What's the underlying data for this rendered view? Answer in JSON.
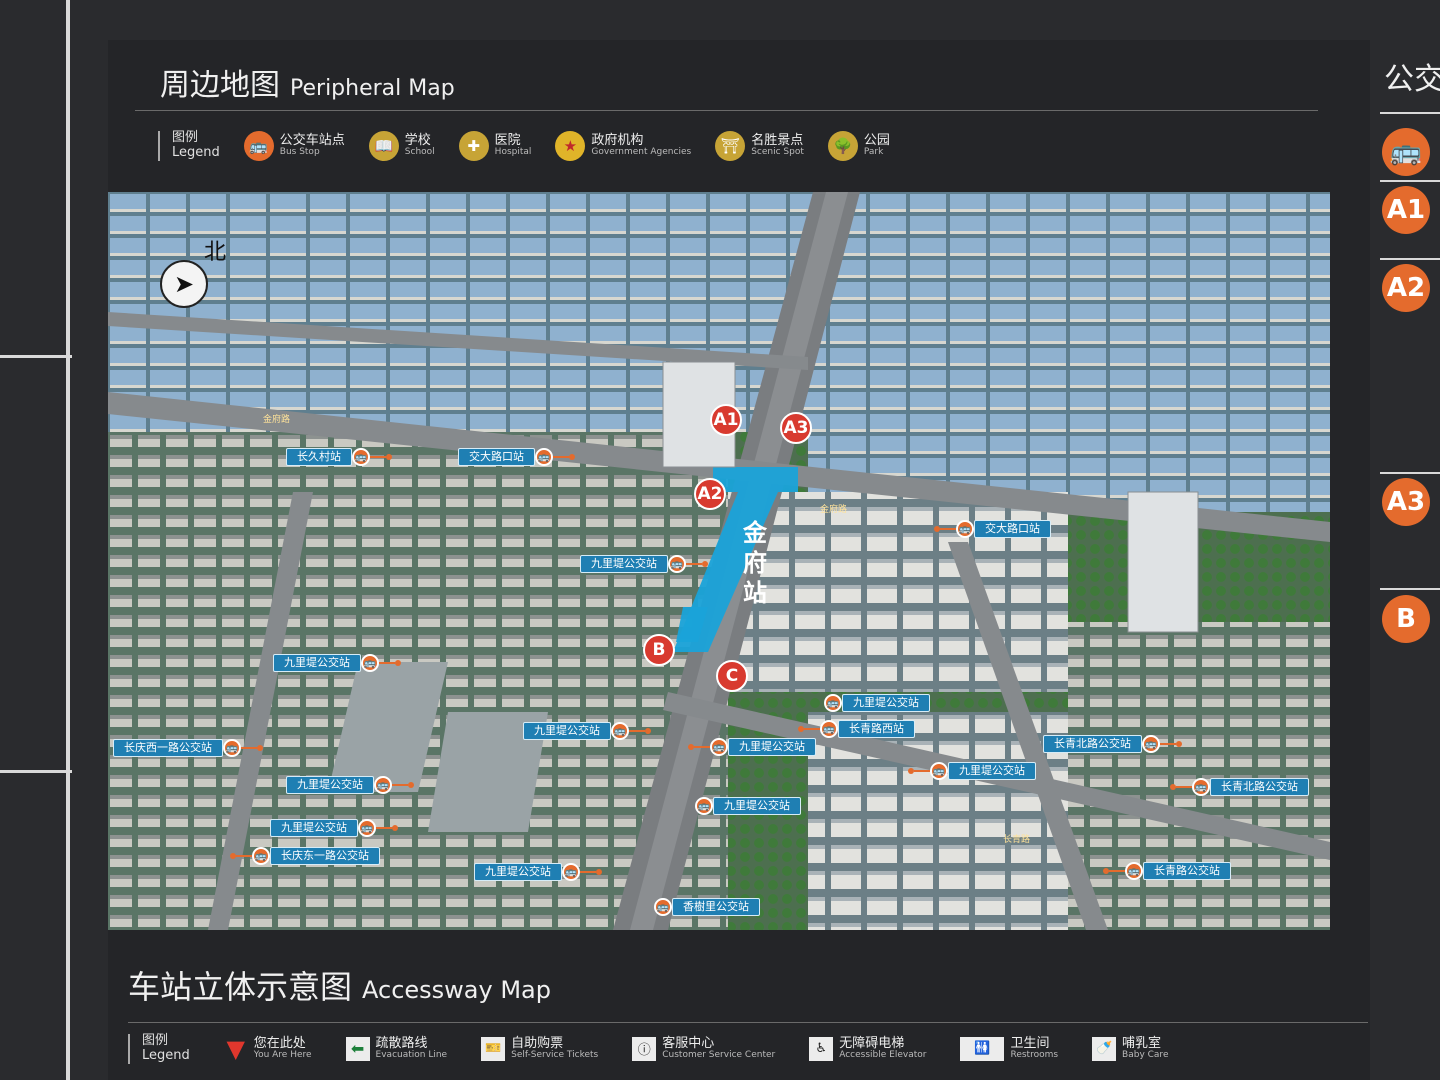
{
  "peripheral": {
    "title_zh": "周边地图",
    "title_en": "Peripheral Map",
    "legend_zh": "图例",
    "legend_en": "Legend",
    "legend_items": [
      {
        "zh": "公交车站点",
        "en": "Bus Stop",
        "icon": "bus-icon",
        "color": "#e46b2d"
      },
      {
        "zh": "学校",
        "en": "School",
        "icon": "book-icon",
        "color": "#c7a436"
      },
      {
        "zh": "医院",
        "en": "Hospital",
        "icon": "hospital-icon",
        "color": "#c7a436"
      },
      {
        "zh": "政府机构",
        "en": "Government Agencies",
        "icon": "star-icon",
        "color": "#e0b429"
      },
      {
        "zh": "名胜景点",
        "en": "Scenic Spot",
        "icon": "gate-icon",
        "color": "#c7a436"
      },
      {
        "zh": "公园",
        "en": "Park",
        "icon": "tree-icon",
        "color": "#c7a436"
      }
    ]
  },
  "map": {
    "north_label": "北",
    "station_name": "金府站",
    "road_names": [
      "金府路",
      "金府路",
      "长青路"
    ],
    "exits": [
      "A1",
      "A2",
      "A3",
      "B",
      "C"
    ],
    "bus_stops": [
      "长久村站",
      "交大路口站",
      "交大路口站",
      "九里堤公交站",
      "九里堤公交站",
      "九里堤公交站",
      "九里堤公交站",
      "长青路西站",
      "九里堤公交站",
      "长青北路公交站",
      "长庆西一路公交站",
      "九里堤公交站",
      "九里堤公交站",
      "长青北路公交站",
      "九里堤公交站",
      "九里堤公交站",
      "长庆东一路公交站",
      "长青路公交站",
      "九里堤公交站",
      "香樹里公交站"
    ]
  },
  "side": {
    "title": "公交",
    "items": [
      "A1",
      "A2",
      "A3",
      "B"
    ]
  },
  "accessway": {
    "title_zh": "车站立体示意图",
    "title_en": "Accessway Map",
    "legend_zh": "图例",
    "legend_en": "Legend",
    "legend_items": [
      {
        "zh": "您在此处",
        "en": "You Are Here",
        "icon": "you-are-here-icon"
      },
      {
        "zh": "疏散路线",
        "en": "Evacuation Line",
        "icon": "arrow-left-icon"
      },
      {
        "zh": "自助购票",
        "en": "Self-Service Tickets",
        "icon": "ticket-icon"
      },
      {
        "zh": "客服中心",
        "en": "Customer Service Center",
        "icon": "service-icon"
      },
      {
        "zh": "无障碍电梯",
        "en": "Accessible Elevator",
        "icon": "elevator-icon"
      },
      {
        "zh": "卫生间",
        "en": "Restrooms",
        "icon": "restroom-icon"
      },
      {
        "zh": "哺乳室",
        "en": "Baby Care",
        "icon": "baby-care-icon"
      }
    ]
  },
  "colors": {
    "bus_orange": "#e46b2d",
    "exit_red": "#d83a2f",
    "station_blue": "#1aa3d9",
    "label_blue": "#1f7fb3"
  }
}
